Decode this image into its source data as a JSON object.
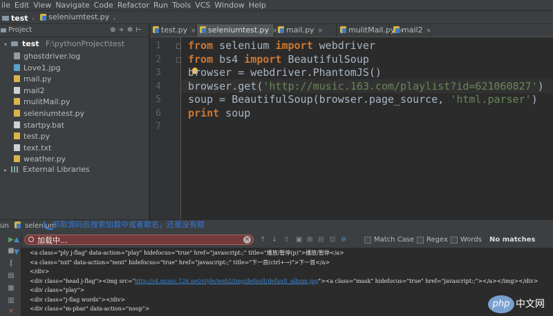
{
  "menubar": [
    "ile",
    "Edit",
    "View",
    "Navigate",
    "Code",
    "Refactor",
    "Run",
    "Tools",
    "VCS",
    "Window",
    "Help"
  ],
  "breadcrumb": {
    "project": "test",
    "file": "seleniumtest.py"
  },
  "project_panel": {
    "title": "Project",
    "root": {
      "name": "test",
      "path": "F:\\pythonProject\\test"
    },
    "files": [
      {
        "name": "ghostdriver.log",
        "icon": "log-file-icon",
        "color": "#9a9a9a"
      },
      {
        "name": "Love1.jpg",
        "icon": "image-file-icon",
        "color": "#5aa0c8"
      },
      {
        "name": "mail.py",
        "icon": "python-file-icon",
        "color": "#d9b44a"
      },
      {
        "name": "mail2",
        "icon": "text-file-icon",
        "color": "#cfcfcf"
      },
      {
        "name": "mulitMail.py",
        "icon": "python-file-icon",
        "color": "#d9b44a"
      },
      {
        "name": "seleniumtest.py",
        "icon": "python-file-icon",
        "color": "#d9b44a"
      },
      {
        "name": "startpy.bat",
        "icon": "bat-file-icon",
        "color": "#cfcfcf"
      },
      {
        "name": "test.py",
        "icon": "python-file-icon",
        "color": "#d9b44a"
      },
      {
        "name": "text.txt",
        "icon": "text-file-icon",
        "color": "#cfcfcf"
      },
      {
        "name": "weather.py",
        "icon": "python-file-icon",
        "color": "#d9b44a"
      }
    ],
    "external": "External Libraries"
  },
  "tabs": [
    {
      "label": "test.py",
      "active": false
    },
    {
      "label": "seleniumtest.py",
      "active": true
    },
    {
      "label": "mail.py",
      "active": false
    },
    {
      "label": "mulitMail.py",
      "active": false
    },
    {
      "label": "mail2",
      "active": false
    }
  ],
  "editor": {
    "line_numbers": [
      "1",
      "2",
      "3",
      "4",
      "5",
      "6",
      "7"
    ],
    "lines": [
      [
        {
          "t": "from",
          "c": "kw"
        },
        {
          "t": " selenium ",
          "c": ""
        },
        {
          "t": "import",
          "c": "kw"
        },
        {
          "t": " webdriver",
          "c": ""
        }
      ],
      [
        {
          "t": "from",
          "c": "kw"
        },
        {
          "t": " bs4 ",
          "c": ""
        },
        {
          "t": "import",
          "c": "kw"
        },
        {
          "t": " BeautifulSoup",
          "c": ""
        }
      ],
      [
        {
          "t": "browser = webdriver.PhantomJS()",
          "c": ""
        }
      ],
      [
        {
          "t": "browser.get(",
          "c": ""
        },
        {
          "t": "'http://music.163.com/playlist?id=621060827'",
          "c": "str"
        },
        {
          "t": ")",
          "c": ""
        }
      ],
      [
        {
          "t": "soup = BeautifulSoup(browser.page_source, ",
          "c": ""
        },
        {
          "t": "'html.parser'",
          "c": "str"
        },
        {
          "t": ")",
          "c": ""
        }
      ],
      [
        {
          "t": "print",
          "c": "kw"
        },
        {
          "t": " soup",
          "c": ""
        }
      ],
      []
    ]
  },
  "run_panel": {
    "label": "un",
    "config": "selenium",
    "annotation": "抓取源码后搜索加载中或者歌名，还是没有额"
  },
  "search": {
    "value": "加载中...",
    "match_case": "Match Case",
    "regex": "Regex",
    "words": "Words",
    "result": "No matches"
  },
  "console_lines": [
    [
      {
        "t": "<a class=\"ply j-flag\" data-action=\"play\" hidefocus=\"true\" href=\"javascript:;\" title=\"播放/暂停(p)\">播放/暂停</a>"
      }
    ],
    [
      {
        "t": "<a class=\"nxt\" data-action=\"next\" hidefocus=\"true\" href=\"javascript:;\" title=\"下一首(ctrl+→)\">下一首</a>"
      }
    ],
    [
      {
        "t": "</div>"
      }
    ],
    [
      {
        "t": "<div class=\"head j-flag\"><img src=\""
      },
      {
        "t": "http://s4.music.126.net/style/web2/img/default/default_album.jpg",
        "link": true
      },
      {
        "t": "\"><a class=\"mask\" hidefocus=\"true\" href=\"javascript:;\"></a></img></div>"
      }
    ],
    [
      {
        "t": "<div class=\"play\">"
      }
    ],
    [
      {
        "t": "<div class=\"j-flag words\"></div>"
      }
    ],
    [
      {
        "t": "<div class=\"m-pbar\" data-action=\"noop\">"
      }
    ]
  ],
  "watermark": {
    "logo": "php",
    "text": "中文网"
  },
  "colors": {
    "keyword": "#cc7832",
    "string": "#6a8759",
    "annotation": "#2e78e0",
    "search_error_bg": "#743a3a"
  }
}
